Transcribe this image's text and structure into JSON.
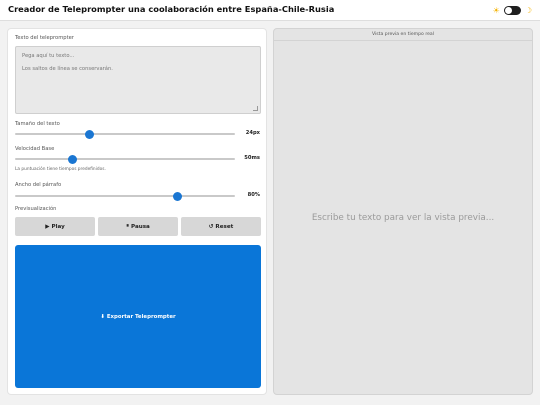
{
  "header": {
    "title": "Creador de Teleprompter una coolaboración entre España-Chile-Rusia",
    "theme": {
      "sun_icon": "☀",
      "moon_icon": "☽",
      "dark_mode_enabled": false
    }
  },
  "editor": {
    "text_label": "Texto del teleprompter",
    "placeholder_lines": [
      "Pega aquí tu texto...",
      "Los saltos de línea se conservarán."
    ],
    "text_value": ""
  },
  "controls": {
    "font_size": {
      "label": "Tamaño del texto",
      "value": "24px",
      "percent": 34
    },
    "base_speed": {
      "label": "Velocidad Base",
      "value": "50ms",
      "percent": 26,
      "hint": "La puntuación tiene tiempos predefinidos."
    },
    "paragraph_width": {
      "label": "Ancho del párrafo",
      "value": "80%",
      "percent": 74
    }
  },
  "preview_controls": {
    "label": "Previsualización",
    "play": {
      "icon": "▶",
      "label": "Play"
    },
    "pause": {
      "icon": "⏸",
      "label": "Pausa"
    },
    "reset": {
      "icon": "↺",
      "label": "Reset"
    }
  },
  "export": {
    "icon": "⬇",
    "label": "Exportar Teleprompter",
    "color": "#0a76d8"
  },
  "preview": {
    "title": "Vista previa en tiempo real",
    "empty_message": "Escribe tu texto para ver la vista previa..."
  }
}
